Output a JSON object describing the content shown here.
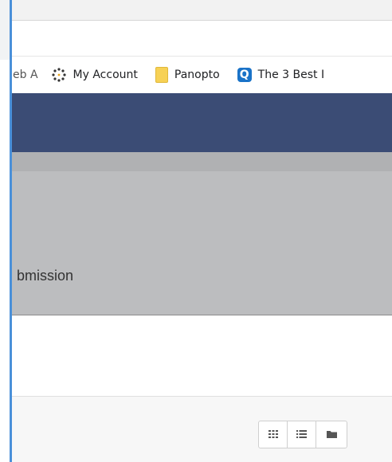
{
  "bookmarks": {
    "partial_label_visible": "eb A",
    "items": [
      {
        "label": "My Account",
        "icon": "dotted-circle-icon"
      },
      {
        "label": "Panopto",
        "icon": "folder-icon"
      },
      {
        "label": "The 3 Best I",
        "icon": "q-app-icon",
        "icon_glyph": "Q"
      }
    ]
  },
  "content": {
    "partial_text": "bmission"
  },
  "view_toggles": [
    {
      "name": "grid-view",
      "icon": "grid-icon"
    },
    {
      "name": "list-view",
      "icon": "list-icon"
    },
    {
      "name": "folder-view",
      "icon": "folder-icon"
    }
  ],
  "colors": {
    "header": "#3b4c75",
    "content_gray": "#bcbdbf",
    "sub_bar": "#b0b1b3",
    "accent_edge": "#4a90d9"
  }
}
